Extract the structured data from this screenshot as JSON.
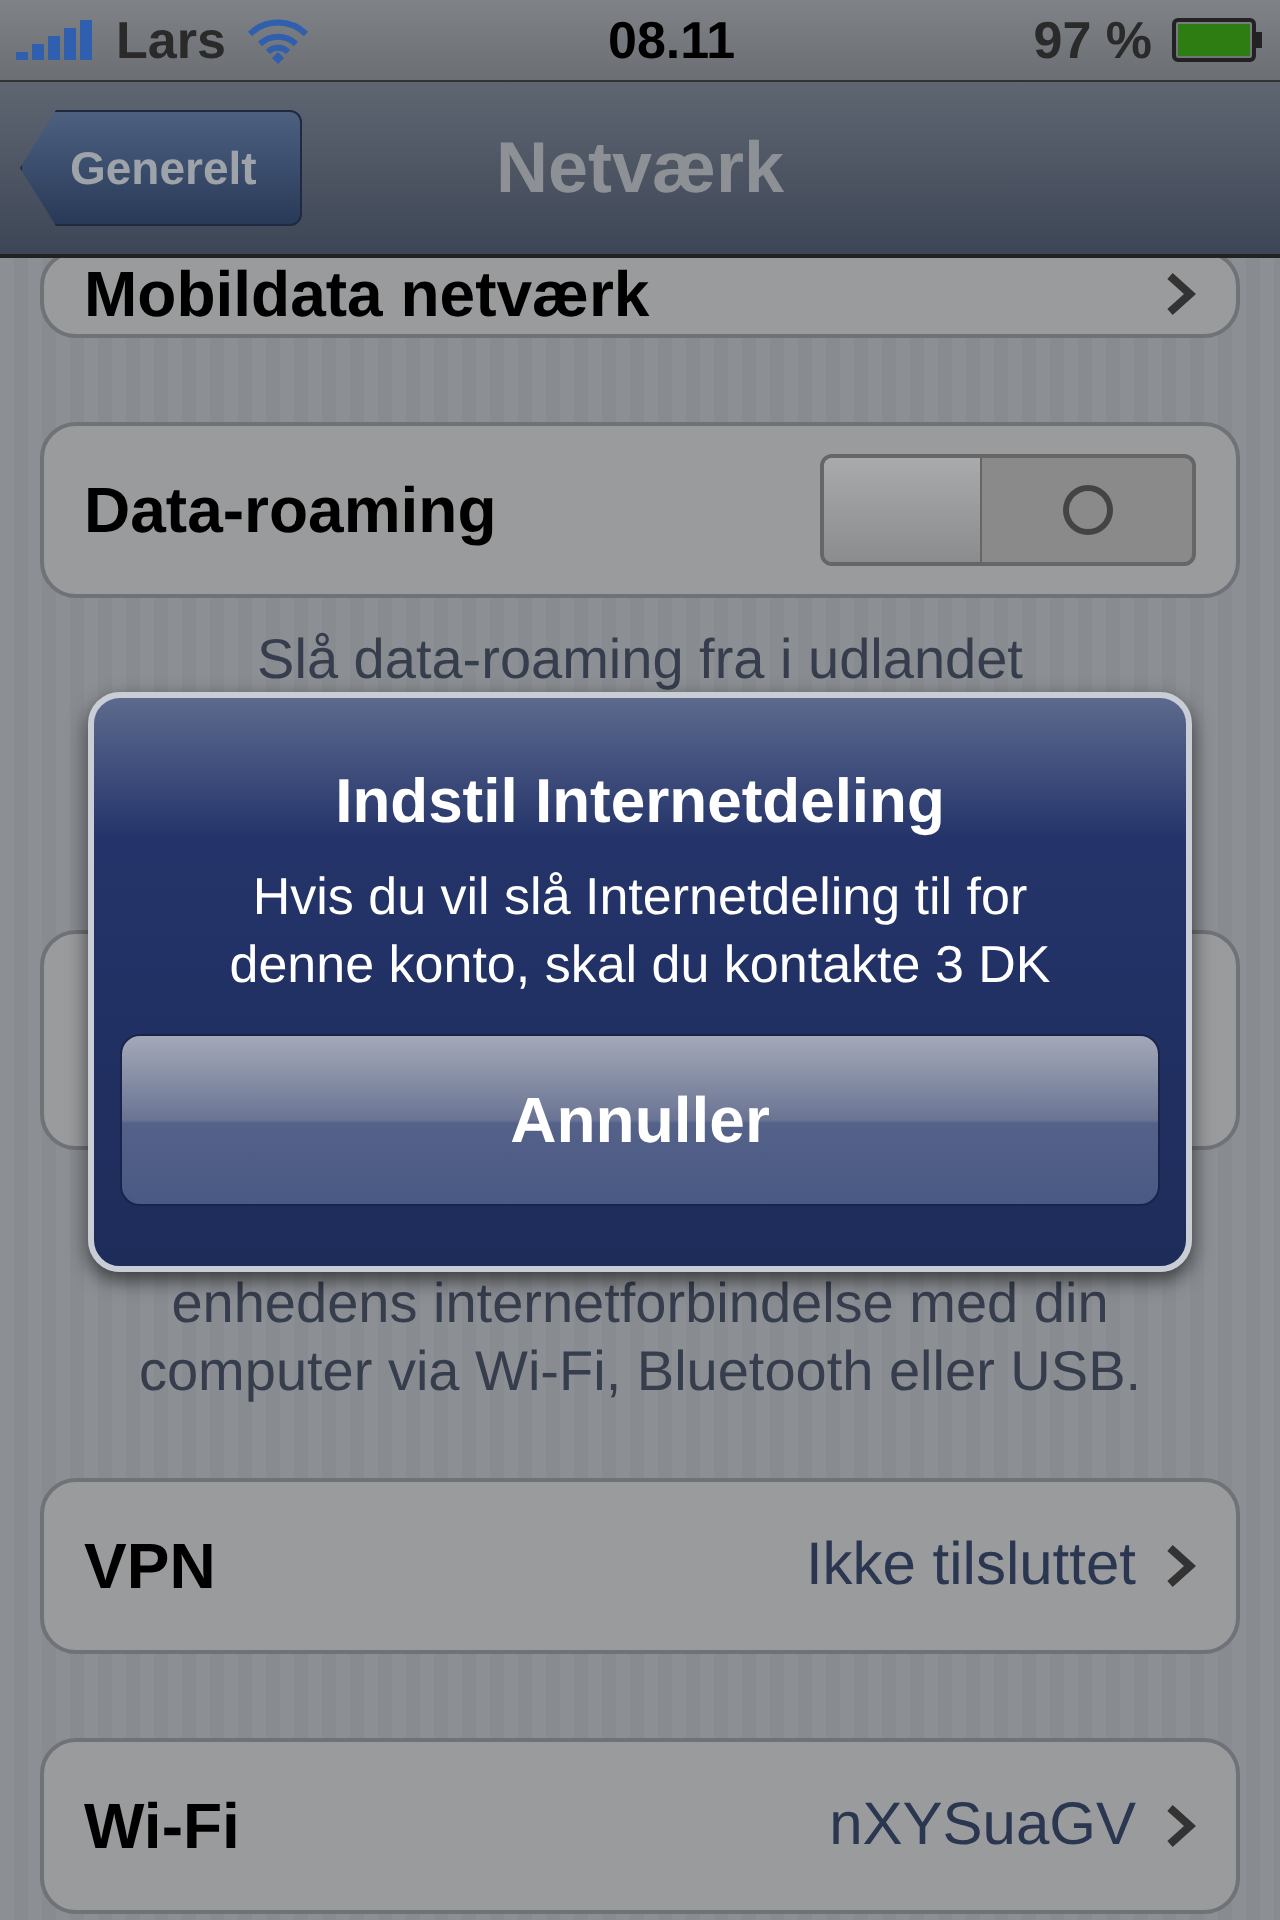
{
  "status_bar": {
    "carrier": "Lars",
    "time": "08.11",
    "battery_text": "97 %"
  },
  "nav": {
    "back": "Generelt",
    "title": "Netværk"
  },
  "mobile_row": {
    "label": "Mobildata netværk"
  },
  "roaming": {
    "label": "Data-roaming",
    "on": false,
    "footer": "Slå data-roaming fra i udlandet"
  },
  "sharing": {
    "footer": "enhedens internetforbindelse med din computer via Wi-Fi, Bluetooth eller USB."
  },
  "rows": [
    {
      "label": "VPN",
      "value": "Ikke tilsluttet"
    },
    {
      "label": "Wi-Fi",
      "value": "nXYSuaGV"
    }
  ],
  "alert": {
    "title": "Indstil Internetdeling",
    "message": "Hvis du vil slå Internetdeling til for denne konto, skal du kontakte 3 DK",
    "buttons": [
      "Annuller"
    ]
  }
}
